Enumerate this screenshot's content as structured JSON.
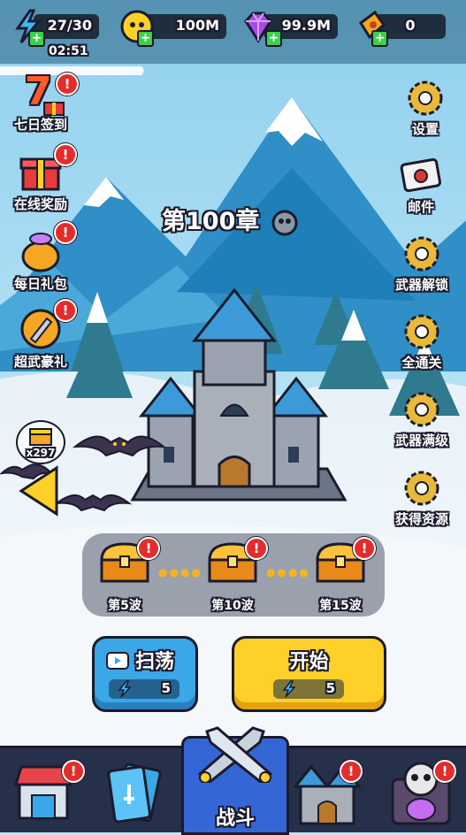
{
  "resources": [
    {
      "id": "energy",
      "value": "27/30",
      "icon": "lightning-icon"
    },
    {
      "id": "coins",
      "value": "100M",
      "icon": "coin-icon"
    },
    {
      "id": "gems",
      "value": "99.9M",
      "icon": "gem-icon"
    },
    {
      "id": "tickets",
      "value": "0",
      "icon": "ticket-icon"
    }
  ],
  "timer": "02:51",
  "left_menu": [
    {
      "label": "七日签到",
      "icon": "seven-day-gift-icon",
      "number": "7"
    },
    {
      "label": "在线奖励",
      "icon": "gift-box-icon"
    },
    {
      "label": "每日礼包",
      "icon": "gold-bag-icon"
    },
    {
      "label": "超武豪礼",
      "icon": "super-weapon-icon"
    }
  ],
  "right_menu": [
    {
      "label": "设置",
      "icon": "gear-icon"
    },
    {
      "label": "邮件",
      "icon": "mail-icon"
    },
    {
      "label": "武器解锁",
      "icon": "gear-icon"
    },
    {
      "label": "全通关",
      "icon": "gear-icon"
    },
    {
      "label": "武器满级",
      "icon": "gear-icon"
    },
    {
      "label": "获得资源",
      "icon": "gear-icon"
    }
  ],
  "chapter_title": "第100章",
  "side_chest_count": "x297",
  "wave_rewards": [
    {
      "label": "第5波"
    },
    {
      "label": "第10波"
    },
    {
      "label": "第15波"
    }
  ],
  "sweep_button": {
    "label": "扫荡",
    "cost": "5"
  },
  "start_button": {
    "label": "开始",
    "cost": "5"
  },
  "bottom_nav": [
    {
      "id": "shop",
      "icon": "shop-icon"
    },
    {
      "id": "cards",
      "icon": "cards-icon"
    },
    {
      "id": "battle",
      "icon": "crossed-swords-icon",
      "label": "战斗"
    },
    {
      "id": "castle",
      "icon": "castle-icon"
    },
    {
      "id": "skull",
      "icon": "skull-portal-icon"
    }
  ],
  "colors": {
    "badge": "#e52c2c",
    "start": "#ffd028",
    "sweep": "#3aa7e8",
    "nav": "#27304a",
    "battle_tab": "#3466d6"
  }
}
